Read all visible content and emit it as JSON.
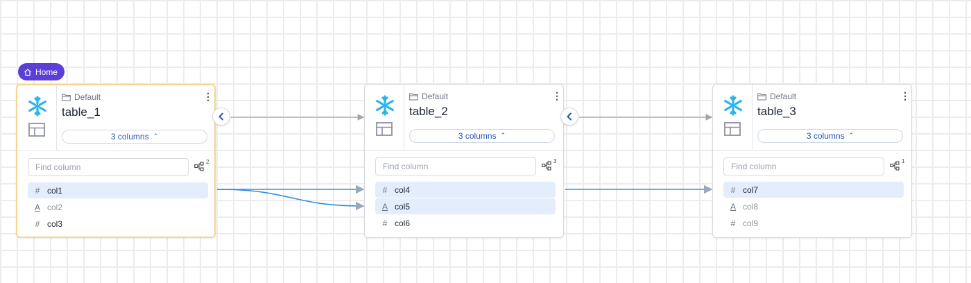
{
  "home_badge": {
    "label": "Home",
    "icon": "home-icon"
  },
  "colors": {
    "accent": "#5b3fd6",
    "highlight": "#e3edfc",
    "edge": "#2f8de4",
    "selected_border": "#f6d58e",
    "snowflake": "#29b5e8"
  },
  "nodes": [
    {
      "folder": "Default",
      "name": "table_1",
      "columns_label": "3 columns",
      "search_placeholder": "Find column",
      "lineage_count": "2",
      "columns": [
        {
          "name": "col1",
          "type": "#",
          "highlight": true,
          "dim": false
        },
        {
          "name": "col2",
          "type": "A",
          "highlight": false,
          "dim": true
        },
        {
          "name": "col3",
          "type": "#",
          "highlight": false,
          "dim": false
        }
      ]
    },
    {
      "folder": "Default",
      "name": "table_2",
      "columns_label": "3 columns",
      "search_placeholder": "Find column",
      "lineage_count": "3",
      "columns": [
        {
          "name": "col4",
          "type": "#",
          "highlight": true,
          "dim": false
        },
        {
          "name": "col5",
          "type": "A",
          "highlight": true,
          "dim": false
        },
        {
          "name": "col6",
          "type": "#",
          "highlight": false,
          "dim": false
        }
      ]
    },
    {
      "folder": "Default",
      "name": "table_3",
      "columns_label": "3 columns",
      "search_placeholder": "Find column",
      "lineage_count": "1",
      "columns": [
        {
          "name": "col7",
          "type": "#",
          "highlight": true,
          "dim": false
        },
        {
          "name": "col8",
          "type": "A",
          "highlight": false,
          "dim": true
        },
        {
          "name": "col9",
          "type": "#",
          "highlight": false,
          "dim": true
        }
      ]
    }
  ]
}
